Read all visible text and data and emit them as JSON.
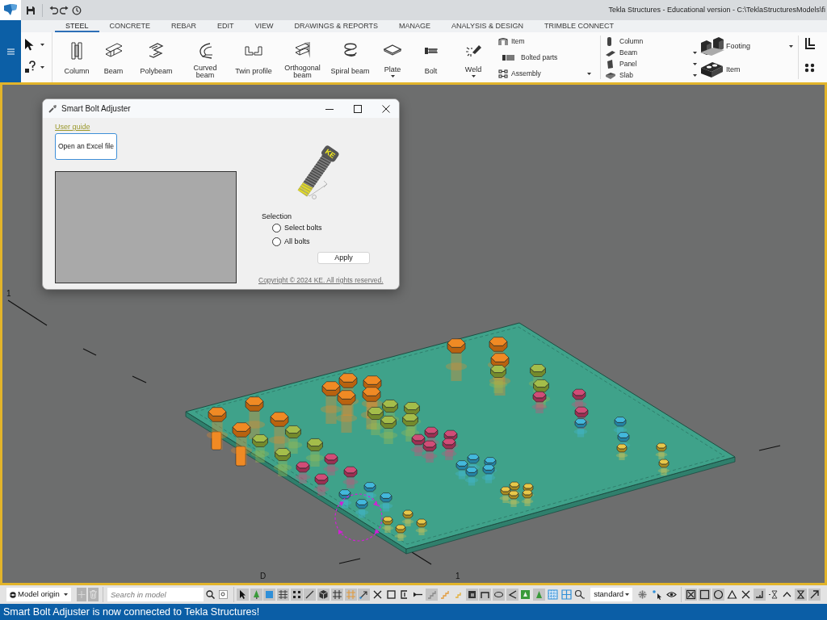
{
  "window": {
    "title": "Tekla Structures - Educational version - C:\\TeklaStructuresModels\\fi"
  },
  "ribbon_tabs": [
    {
      "label": "STEEL",
      "selected": true
    },
    {
      "label": "CONCRETE",
      "selected": false
    },
    {
      "label": "REBAR",
      "selected": false
    },
    {
      "label": "EDIT",
      "selected": false
    },
    {
      "label": "VIEW",
      "selected": false
    },
    {
      "label": "DRAWINGS & REPORTS",
      "selected": false
    },
    {
      "label": "MANAGE",
      "selected": false
    },
    {
      "label": "ANALYSIS & DESIGN",
      "selected": false
    },
    {
      "label": "TRIMBLE CONNECT",
      "selected": false
    }
  ],
  "ribbon": {
    "large_buttons": [
      {
        "label": "Column",
        "dropdown": false
      },
      {
        "label": "Beam",
        "dropdown": false
      },
      {
        "label": "Polybeam",
        "dropdown": false
      },
      {
        "label": "Curved beam",
        "dropdown": false
      },
      {
        "label": "Twin profile",
        "dropdown": false
      },
      {
        "label": "Orthogonal beam",
        "dropdown": false
      },
      {
        "label": "Spiral beam",
        "dropdown": false
      },
      {
        "label": "Plate",
        "dropdown": true
      },
      {
        "label": "Bolt",
        "dropdown": false
      },
      {
        "label": "Weld",
        "dropdown": true
      }
    ],
    "steel_small_buttons": [
      {
        "label": "Item",
        "dropdown": false
      },
      {
        "label": "Bolted parts",
        "dropdown": false
      },
      {
        "label": "Assembly",
        "dropdown": true
      }
    ],
    "concrete_buttons": [
      {
        "label": "Column",
        "dropdown": false
      },
      {
        "label": "Beam",
        "dropdown": true
      },
      {
        "label": "Panel",
        "dropdown": true
      },
      {
        "label": "Slab",
        "dropdown": true
      }
    ],
    "footing_buttons": [
      {
        "label": "Footing",
        "dropdown": true
      },
      {
        "label": "Item",
        "dropdown": false
      }
    ]
  },
  "dialog": {
    "title": "Smart Bolt Adjuster",
    "link": "User guide",
    "open_button": "Open an Excel file",
    "logo_text": "KE",
    "selection": {
      "label": "Selection",
      "options": [
        {
          "label": "Select bolts",
          "selected": false
        },
        {
          "label": "All bolts",
          "selected": false
        }
      ]
    },
    "apply_button": "Apply",
    "copyright": "Copyright © 2024 KE. All rights reserved."
  },
  "view": {
    "grid_labels": [
      "1",
      "D",
      "1"
    ]
  },
  "bottom_toolbar": {
    "origin": "Model origin",
    "search": {
      "placeholder": "Search in model"
    },
    "representation": "standard"
  },
  "status_bar": {
    "message": "Smart Bolt Adjuster is now connected to Tekla Structures!"
  }
}
